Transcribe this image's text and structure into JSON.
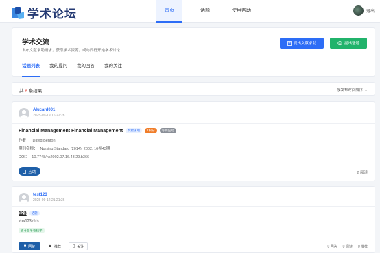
{
  "nav": {
    "logo_text": "学术论坛",
    "links": [
      "首页",
      "话题",
      "使用帮助"
    ],
    "active_index": 0,
    "user_name": "退出"
  },
  "header": {
    "title": "学术交流",
    "subtitle": "发布文献求助请求，获取学术资源，或与同行开始学术讨论",
    "btn_request": "提出文献求助",
    "btn_topic": "提出话题",
    "tabs": [
      "话题列表",
      "我的提问",
      "我的回答",
      "我的关注"
    ],
    "active_tab": 0
  },
  "results": {
    "prefix": "共",
    "count": "8",
    "suffix": "条结果",
    "sort_label": "按发布时间降序"
  },
  "posts": [
    {
      "author": "Alucard001",
      "time": "2025-09-19 16:22:28",
      "title": "Financial Management Financial Management",
      "badges": [
        "文献求助",
        "1积分",
        "等待应助"
      ],
      "author_label": "作者：",
      "author_value": "David Benton",
      "journal_label": "期刊名称：",
      "journal_value": "Nursing Standard (2014); 2002; 16卷43期",
      "doi_label": "DOI：",
      "doi_value": "10.7748/ns2002.07.16.43.29.b366",
      "action": "应助",
      "views": "2 阅读"
    },
    {
      "author": "test123",
      "time": "2025-09-12 21:21:36",
      "title": "123",
      "badge": "话题",
      "body": "<u>123</u>",
      "tag": "农业与生物科学",
      "actions": [
        "回复",
        "推荐",
        "关注"
      ],
      "stats": [
        "0 回答",
        "0 阅读",
        "0 推荐"
      ]
    }
  ],
  "colors": {
    "primary": "#2d6df6",
    "green": "#21b36b",
    "dark_button": "#1e5fa8",
    "orange": "#f07d2a",
    "count_red": "#e6443a"
  }
}
